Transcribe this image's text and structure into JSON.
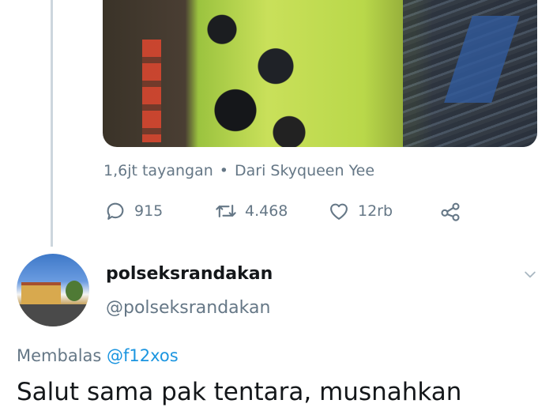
{
  "previous_tweet": {
    "views": "1,6jt tayangan",
    "separator": "•",
    "source": "Dari Skyqueen Yee",
    "actions": {
      "reply_count": "915",
      "retweet_count": "4.468",
      "like_count": "12rb"
    }
  },
  "reply_tweet": {
    "display_name": "polseksrandakan",
    "handle": "@polseksrandakan",
    "replying_to_label": "Membalas",
    "replying_to_mention": "@f12xos",
    "text": "Salut sama pak tentara, musnahkan"
  },
  "icons": [
    "reply-icon",
    "retweet-icon",
    "like-icon",
    "share-icon",
    "chevron-down-icon"
  ],
  "colors": {
    "muted_text": "#657786",
    "mention_link": "#1b95e0",
    "thread_line": "#ccd6dd"
  }
}
